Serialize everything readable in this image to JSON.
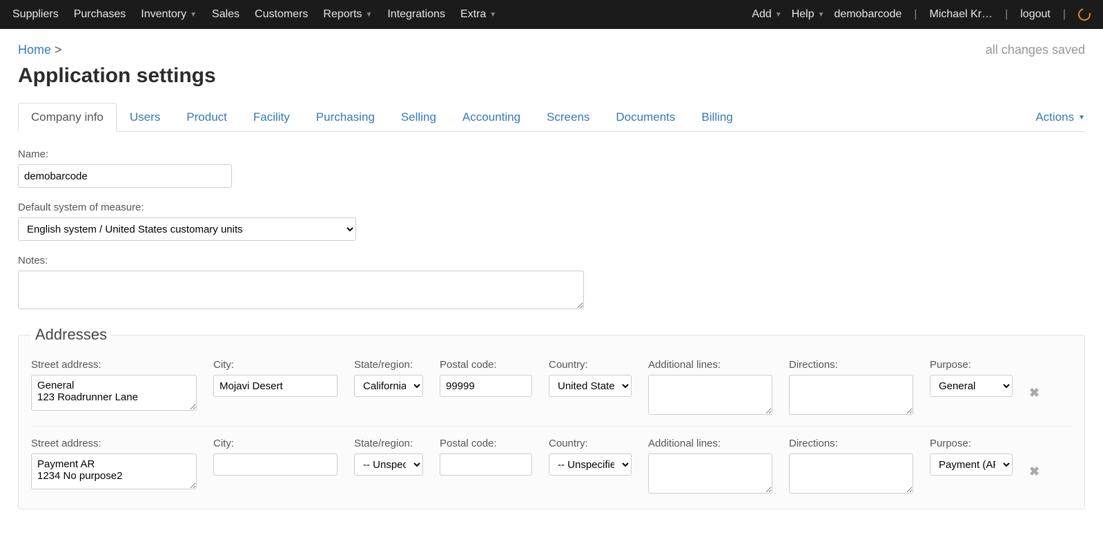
{
  "nav": {
    "left": [
      "Suppliers",
      "Purchases",
      "Inventory",
      "Sales",
      "Customers",
      "Reports",
      "Integrations",
      "Extra"
    ],
    "dropdown_indices": [
      2,
      5,
      7
    ],
    "add": "Add",
    "help": "Help",
    "account": "demobarcode",
    "user": "Michael Kr…",
    "logout": "logout"
  },
  "breadcrumb": {
    "home": "Home",
    "sep": ">"
  },
  "status": "all changes saved",
  "page_title": "Application settings",
  "tabs": [
    "Company info",
    "Users",
    "Product",
    "Facility",
    "Purchasing",
    "Selling",
    "Accounting",
    "Screens",
    "Documents",
    "Billing"
  ],
  "actions_label": "Actions",
  "form": {
    "name_label": "Name:",
    "name_value": "demobarcode",
    "measure_label": "Default system of measure:",
    "measure_value": "English system / United States customary units",
    "notes_label": "Notes:",
    "notes_value": ""
  },
  "addresses_legend": "Addresses",
  "address_labels": {
    "street": "Street address:",
    "city": "City:",
    "state": "State/region:",
    "postal": "Postal code:",
    "country": "Country:",
    "additional": "Additional lines:",
    "directions": "Directions:",
    "purpose": "Purpose:"
  },
  "addresses": [
    {
      "street": "General\n123 Roadrunner Lane",
      "city": "Mojavi Desert",
      "state": "California",
      "postal": "99999",
      "country": "United States",
      "additional": "",
      "directions": "",
      "purpose": "General"
    },
    {
      "street": "Payment AR\n1234 No purpose2",
      "city": "",
      "state": "-- Unspecified --",
      "postal": "",
      "country": "-- Unspecified --",
      "additional": "",
      "directions": "",
      "purpose": "Payment (AR)"
    }
  ]
}
